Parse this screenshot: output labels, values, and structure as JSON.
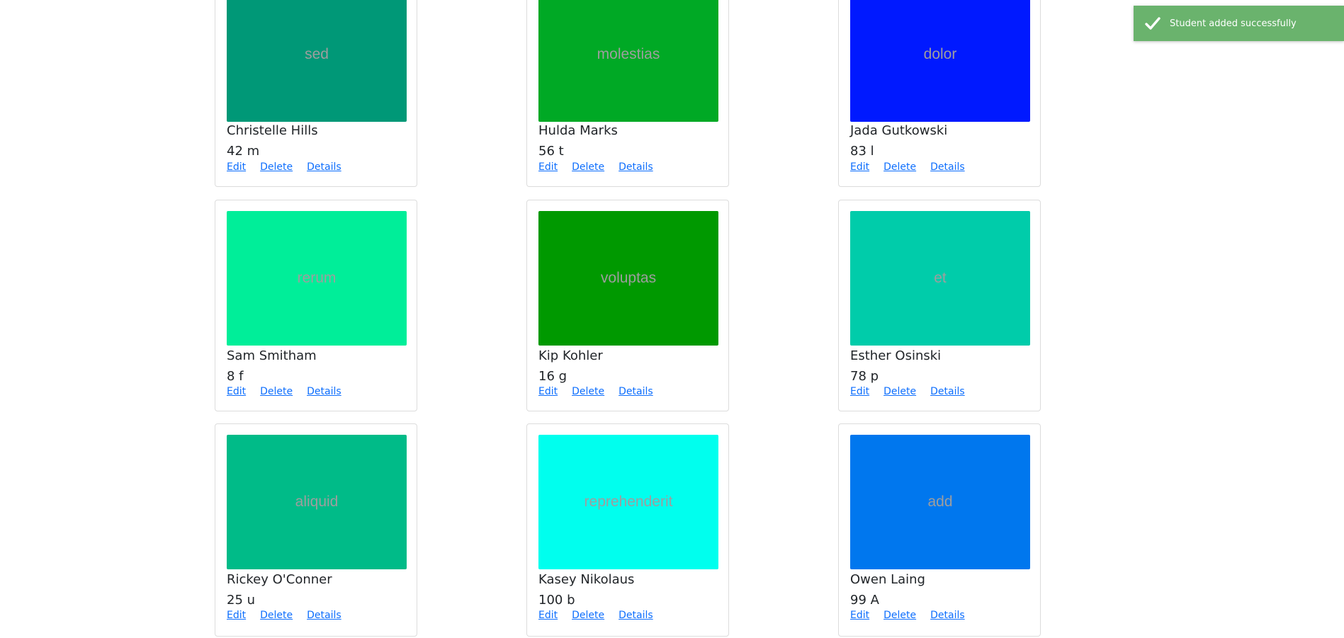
{
  "toast": {
    "message": "Student added successfully",
    "color": "#6ab36d",
    "icon": "check-icon"
  },
  "students": [
    {
      "image_text": "sed",
      "image_color": "#009877",
      "name": "Christelle Hills",
      "meta": "42 m",
      "edit": "Edit",
      "delete": "Delete",
      "details": "Details"
    },
    {
      "image_text": "molestias",
      "image_color": "#00a925",
      "name": "Hulda Marks",
      "meta": "56 t",
      "edit": "Edit",
      "delete": "Delete",
      "details": "Details"
    },
    {
      "image_text": "dolor",
      "image_color": "#0019ff",
      "name": "Jada Gutkowski",
      "meta": "83 l",
      "edit": "Edit",
      "delete": "Delete",
      "details": "Details"
    },
    {
      "image_text": "rerum",
      "image_color": "#00ee99",
      "name": "Sam Smitham",
      "meta": "8 f",
      "edit": "Edit",
      "delete": "Delete",
      "details": "Details"
    },
    {
      "image_text": "voluptas",
      "image_color": "#009900",
      "name": "Kip Kohler",
      "meta": "16 g",
      "edit": "Edit",
      "delete": "Delete",
      "details": "Details"
    },
    {
      "image_text": "et",
      "image_color": "#00ccaa",
      "name": "Esther Osinski",
      "meta": "78 p",
      "edit": "Edit",
      "delete": "Delete",
      "details": "Details"
    },
    {
      "image_text": "aliquid",
      "image_color": "#00bb88",
      "name": "Rickey O'Conner",
      "meta": "25 u",
      "edit": "Edit",
      "delete": "Delete",
      "details": "Details"
    },
    {
      "image_text": "reprehenderit",
      "image_color": "#00ffee",
      "name": "Kasey Nikolaus",
      "meta": "100 b",
      "edit": "Edit",
      "delete": "Delete",
      "details": "Details"
    },
    {
      "image_text": "add",
      "image_color": "#0077ee",
      "name": "Owen Laing",
      "meta": "99 A",
      "edit": "Edit",
      "delete": "Delete",
      "details": "Details"
    }
  ]
}
